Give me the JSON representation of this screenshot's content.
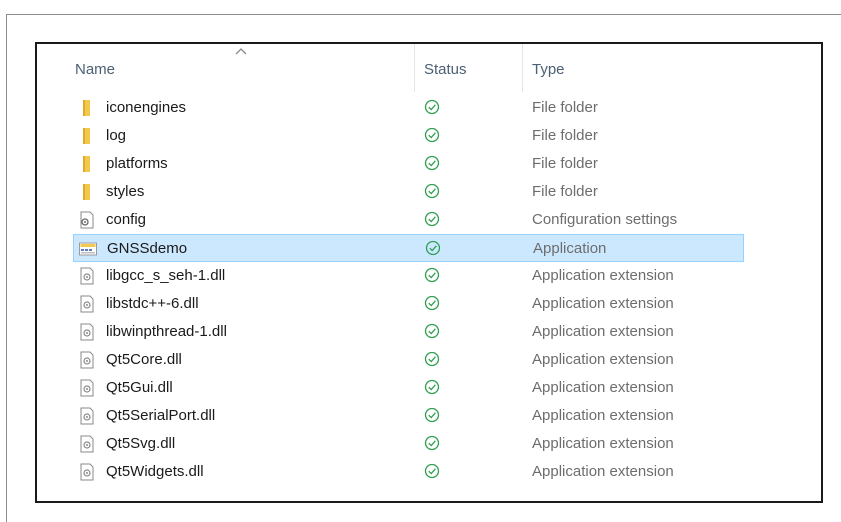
{
  "columns": {
    "name": "Name",
    "status": "Status",
    "type": "Type"
  },
  "colors": {
    "selected_bg": "#cce8ff",
    "selected_border": "#99d1ff",
    "status_ok": "#2e9e4f",
    "folder": "#f3c84b"
  },
  "files": [
    {
      "name": "iconengines",
      "type": "File folder",
      "icon": "folder-icon",
      "status": "synced"
    },
    {
      "name": "log",
      "type": "File folder",
      "icon": "folder-icon",
      "status": "synced"
    },
    {
      "name": "platforms",
      "type": "File folder",
      "icon": "folder-icon",
      "status": "synced"
    },
    {
      "name": "styles",
      "type": "File folder",
      "icon": "folder-icon",
      "status": "synced"
    },
    {
      "name": "config",
      "type": "Configuration settings",
      "icon": "config-file-icon",
      "status": "synced"
    },
    {
      "name": "GNSSdemo",
      "type": "Application",
      "icon": "application-icon",
      "status": "synced",
      "selected": true
    },
    {
      "name": "libgcc_s_seh-1.dll",
      "type": "Application extension",
      "icon": "dll-file-icon",
      "status": "synced"
    },
    {
      "name": "libstdc++-6.dll",
      "type": "Application extension",
      "icon": "dll-file-icon",
      "status": "synced"
    },
    {
      "name": "libwinpthread-1.dll",
      "type": "Application extension",
      "icon": "dll-file-icon",
      "status": "synced"
    },
    {
      "name": "Qt5Core.dll",
      "type": "Application extension",
      "icon": "dll-file-icon",
      "status": "synced"
    },
    {
      "name": "Qt5Gui.dll",
      "type": "Application extension",
      "icon": "dll-file-icon",
      "status": "synced"
    },
    {
      "name": "Qt5SerialPort.dll",
      "type": "Application extension",
      "icon": "dll-file-icon",
      "status": "synced"
    },
    {
      "name": "Qt5Svg.dll",
      "type": "Application extension",
      "icon": "dll-file-icon",
      "status": "synced"
    },
    {
      "name": "Qt5Widgets.dll",
      "type": "Application extension",
      "icon": "dll-file-icon",
      "status": "synced"
    }
  ]
}
